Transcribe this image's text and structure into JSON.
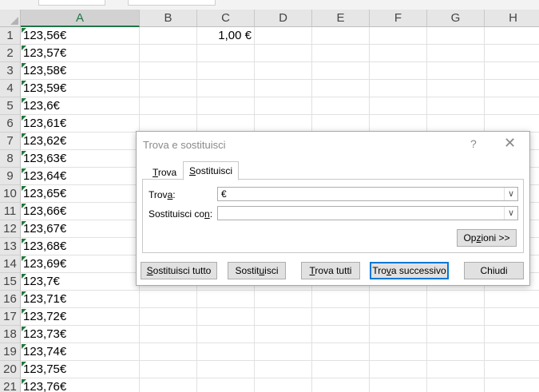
{
  "columns": [
    "A",
    "B",
    "C",
    "D",
    "E",
    "F",
    "G",
    "H"
  ],
  "rows": [
    {
      "n": "1",
      "a": "123,56€",
      "c": "1,00 €"
    },
    {
      "n": "2",
      "a": "123,57€"
    },
    {
      "n": "3",
      "a": "123,58€"
    },
    {
      "n": "4",
      "a": "123,59€"
    },
    {
      "n": "5",
      "a": "123,6€"
    },
    {
      "n": "6",
      "a": "123,61€"
    },
    {
      "n": "7",
      "a": "123,62€"
    },
    {
      "n": "8",
      "a": "123,63€"
    },
    {
      "n": "9",
      "a": "123,64€"
    },
    {
      "n": "10",
      "a": "123,65€"
    },
    {
      "n": "11",
      "a": "123,66€"
    },
    {
      "n": "12",
      "a": "123,67€"
    },
    {
      "n": "13",
      "a": "123,68€"
    },
    {
      "n": "14",
      "a": "123,69€"
    },
    {
      "n": "15",
      "a": "123,7€"
    },
    {
      "n": "16",
      "a": "123,71€"
    },
    {
      "n": "17",
      "a": "123,72€"
    },
    {
      "n": "18",
      "a": "123,73€"
    },
    {
      "n": "19",
      "a": "123,74€"
    },
    {
      "n": "20",
      "a": "123,75€"
    },
    {
      "n": "21",
      "a": "123,76€"
    }
  ],
  "dialog": {
    "title": "Trova e sostituisci",
    "help": "?",
    "close": "✕",
    "tabs": {
      "find": {
        "pre": "",
        "key": "T",
        "post": "rova"
      },
      "replace": {
        "pre": "",
        "key": "S",
        "post": "ostituisci"
      }
    },
    "find_label": {
      "pre": "Trov",
      "key": "a",
      "post": ":"
    },
    "find_value": "€",
    "replace_label": {
      "pre": "Sostituisci co",
      "key": "n",
      "post": ":"
    },
    "replace_value": "",
    "options_button": {
      "pre": "Op",
      "key": "z",
      "post": "ioni >>"
    },
    "buttons": {
      "replace_all": {
        "pre": "",
        "key": "S",
        "post": "ostituisci tutto"
      },
      "replace": {
        "pre": "Sostit",
        "key": "u",
        "post": "isci"
      },
      "find_all": {
        "pre": "",
        "key": "T",
        "post": "rova tutti"
      },
      "find_next": {
        "pre": "Tro",
        "key": "v",
        "post": "a successivo"
      },
      "close": {
        "pre": "Chiudi",
        "key": "",
        "post": ""
      }
    }
  }
}
